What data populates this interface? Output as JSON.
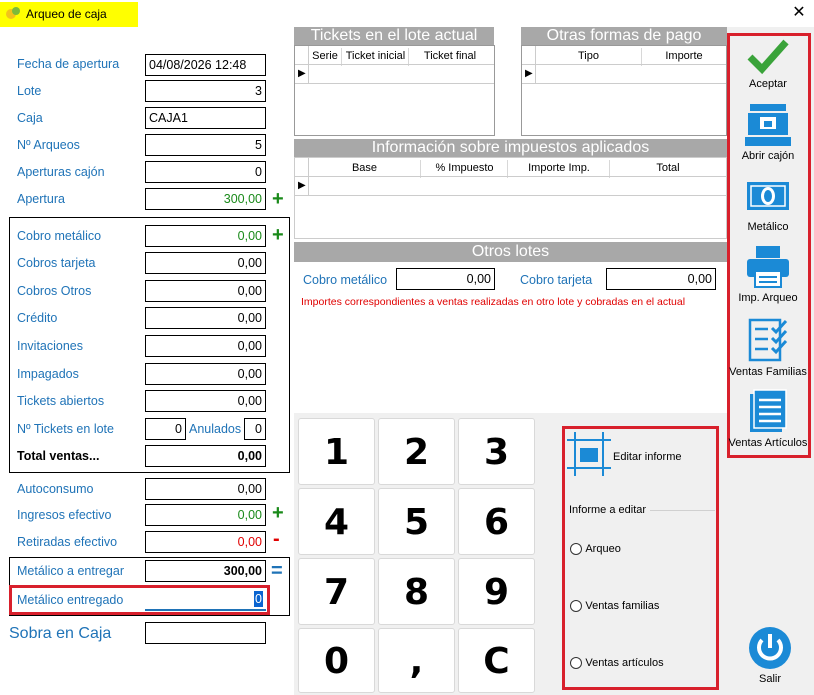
{
  "window": {
    "title": "Arqueo de caja",
    "close_icon": "close-icon"
  },
  "form": {
    "fecha_apertura": {
      "label": "Fecha de apertura",
      "value": "04/08/2026 12:48"
    },
    "lote": {
      "label": "Lote",
      "value": "3"
    },
    "caja": {
      "label": "Caja",
      "value": "CAJA1"
    },
    "num_arqueos": {
      "label": "Nº Arqueos",
      "value": "5"
    },
    "aperturas_cajon": {
      "label": "Aperturas cajón",
      "value": "0"
    },
    "apertura": {
      "label": "Apertura",
      "value": "300,00",
      "sign": "+"
    },
    "cobro_metalico": {
      "label": "Cobro metálico",
      "value": "0,00",
      "sign": "+"
    },
    "cobros_tarjeta": {
      "label": "Cobros tarjeta",
      "value": "0,00"
    },
    "cobros_otros": {
      "label": "Cobros Otros",
      "value": "0,00"
    },
    "credito": {
      "label": "Crédito",
      "value": "0,00"
    },
    "invitaciones": {
      "label": "Invitaciones",
      "value": "0,00"
    },
    "impagados": {
      "label": "Impagados",
      "value": "0,00"
    },
    "tickets_abiertos": {
      "label": "Tickets abiertos",
      "value": "0,00"
    },
    "num_tickets_lote": {
      "label": "Nº Tickets en lote",
      "value": "0"
    },
    "anulados": {
      "label": "Anulados",
      "value": "0"
    },
    "total_ventas": {
      "label": "Total ventas...",
      "value": "0,00"
    },
    "autoconsumo": {
      "label": "Autoconsumo",
      "value": "0,00"
    },
    "ingresos_efectivo": {
      "label": "Ingresos efectivo",
      "value": "0,00",
      "sign": "+"
    },
    "retiradas_efectivo": {
      "label": "Retiradas efectivo",
      "value": "0,00",
      "sign": "-"
    },
    "metalico_entregar": {
      "label": "Metálico a entregar",
      "value": "300,00",
      "sign": "="
    },
    "metalico_entregado": {
      "label": "Metálico entregado",
      "value": "0"
    },
    "sobra_caja": {
      "label": "Sobra en Caja",
      "value": ""
    }
  },
  "tickets_lote": {
    "title": "Tickets en el lote actual",
    "columns": [
      "Serie",
      "Ticket inicial",
      "Ticket final"
    ]
  },
  "otras_formas": {
    "title": "Otras formas de pago",
    "columns": [
      "Tipo",
      "Importe"
    ]
  },
  "impuestos": {
    "title": "Información sobre impuestos aplicados",
    "columns": [
      "Base",
      "% Impuesto",
      "Importe Imp.",
      "Total"
    ]
  },
  "otros_lotes": {
    "title": "Otros lotes",
    "cobro_metalico_label": "Cobro metálico",
    "cobro_metalico_value": "0,00",
    "cobro_tarjeta_label": "Cobro tarjeta",
    "cobro_tarjeta_value": "0,00",
    "note": "Importes correspondientes a ventas realizadas en otro lote y cobradas en el actual"
  },
  "keypad": [
    "1",
    "2",
    "3",
    "4",
    "5",
    "6",
    "7",
    "8",
    "9",
    "0",
    ",",
    "C"
  ],
  "informe": {
    "editar_label": "Editar informe",
    "group_label": "Informe a editar",
    "options": [
      "Arqueo",
      "Ventas familias",
      "Ventas artículos"
    ]
  },
  "toolbar": {
    "aceptar": "Aceptar",
    "abrir_cajon": "Abrir cajón",
    "metalico": "Metálico",
    "imp_arqueo": "Imp. Arqueo",
    "ventas_familias": "Ventas Familias",
    "ventas_articulos": "Ventas Artículos",
    "salir": "Salir"
  },
  "colors": {
    "label_blue": "#1f73b7",
    "highlight_red": "#d8202c",
    "positive_green": "#1a8a1a",
    "negative_red": "#e00000",
    "header_gray": "#a8a8a8",
    "icon_blue": "#1b8ad6",
    "check_green": "#3aa33a"
  }
}
